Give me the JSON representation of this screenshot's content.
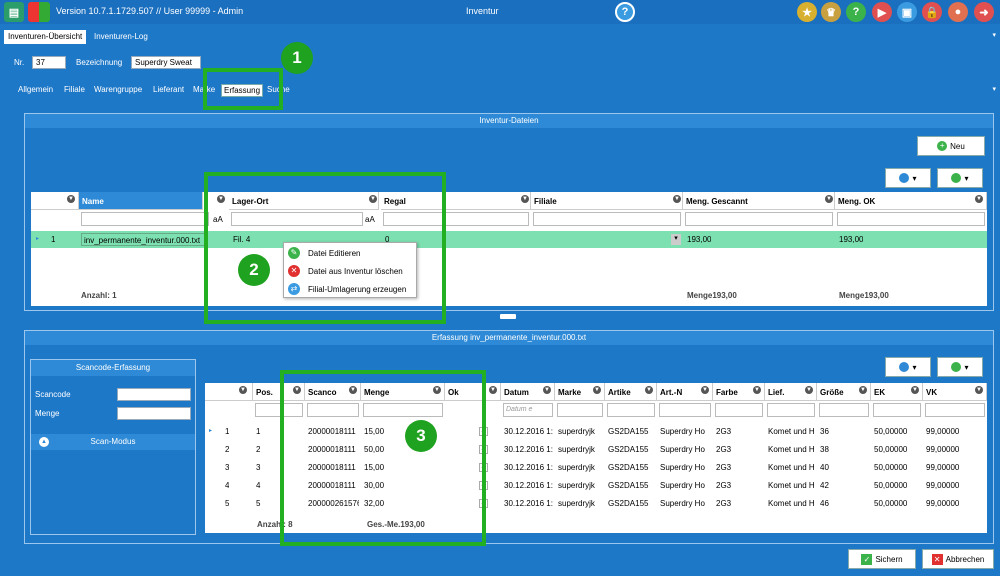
{
  "titlebar": {
    "version": "Version 10.7.1.1729.507  //  User 99999 - Admin",
    "title": "Inventur"
  },
  "tabs": [
    "Inventuren-Übersicht",
    "Inventuren-Log"
  ],
  "form": {
    "nr_label": "Nr.",
    "nr_value": "37",
    "bez_label": "Bezeichnung",
    "bez_value": "Superdry Sweat"
  },
  "subtabs": [
    "Allgemein",
    "Filiale",
    "Warengruppe",
    "Lieferant",
    "Marke",
    "Erfassung",
    "Suche"
  ],
  "files_panel": {
    "title": "Inventur-Dateien",
    "new_button": "Neu",
    "columns": [
      "Name",
      "Lager-Ort",
      "Regal",
      "Filiale",
      "Meng. Gescannt",
      "Meng. OK"
    ],
    "filter_aa": "aA",
    "row": {
      "index": "1",
      "name": "inv_permanente_inventur.000.txt",
      "lager": "Fil. 4",
      "regal": "0",
      "gescannt": "193,00",
      "ok": "193,00"
    },
    "footer": {
      "anzahl": "Anzahl: 1",
      "menge1": "Menge193,00",
      "menge2": "Menge193,00"
    }
  },
  "context_menu": [
    "Datei Editieren",
    "Datei aus Inventur löschen",
    "Filial-Umlagerung erzeugen"
  ],
  "erfassung_panel": {
    "title": "Erfassung   inv_permanente_inventur.000.txt",
    "scan_title": "Scancode-Erfassung",
    "scancode_label": "Scancode",
    "menge_label": "Menge",
    "scan_modus": "Scan-Modus",
    "columns": [
      "Pos.",
      "Scanco",
      "Menge",
      "Ok",
      "Datum",
      "Marke",
      "Artike",
      "Art.-N",
      "Farbe",
      "Lief.",
      "Größe",
      "EK",
      "VK"
    ],
    "datum_placeholder": "Datum e",
    "rows": [
      {
        "idx": "1",
        "pos": "1",
        "scan": "20000018111",
        "menge": "15,00",
        "datum": "30.12.2016 1:",
        "marke": "superdryjk",
        "artikel": "GS2DA155",
        "artn": "Superdry Ho",
        "farbe": "2G3",
        "lief": "Komet und H",
        "groesse": "36",
        "ek": "50,00000",
        "vk": "99,00000"
      },
      {
        "idx": "2",
        "pos": "2",
        "scan": "20000018111",
        "menge": "50,00",
        "datum": "30.12.2016 1:",
        "marke": "superdryjk",
        "artikel": "GS2DA155",
        "artn": "Superdry Ho",
        "farbe": "2G3",
        "lief": "Komet und H",
        "groesse": "38",
        "ek": "50,00000",
        "vk": "99,00000"
      },
      {
        "idx": "3",
        "pos": "3",
        "scan": "20000018111",
        "menge": "15,00",
        "datum": "30.12.2016 1:",
        "marke": "superdryjk",
        "artikel": "GS2DA155",
        "artn": "Superdry Ho",
        "farbe": "2G3",
        "lief": "Komet und H",
        "groesse": "40",
        "ek": "50,00000",
        "vk": "99,00000"
      },
      {
        "idx": "4",
        "pos": "4",
        "scan": "20000018111",
        "menge": "30,00",
        "datum": "30.12.2016 1:",
        "marke": "superdryjk",
        "artikel": "GS2DA155",
        "artn": "Superdry Ho",
        "farbe": "2G3",
        "lief": "Komet und H",
        "groesse": "42",
        "ek": "50,00000",
        "vk": "99,00000"
      },
      {
        "idx": "5",
        "pos": "5",
        "scan": "200000261576",
        "menge": "32,00",
        "datum": "30.12.2016 1:",
        "marke": "superdryjk",
        "artikel": "GS2DA155",
        "artn": "Superdry Ho",
        "farbe": "2G3",
        "lief": "Komet und H",
        "groesse": "46",
        "ek": "50,00000",
        "vk": "99,00000"
      }
    ],
    "footer": {
      "anzahl": "Anzahl: 8",
      "ges": "Ges.-Me.193,00"
    }
  },
  "callouts": [
    "1",
    "2",
    "3"
  ],
  "bottom": {
    "save": "Sichern",
    "cancel": "Abbrechen"
  }
}
